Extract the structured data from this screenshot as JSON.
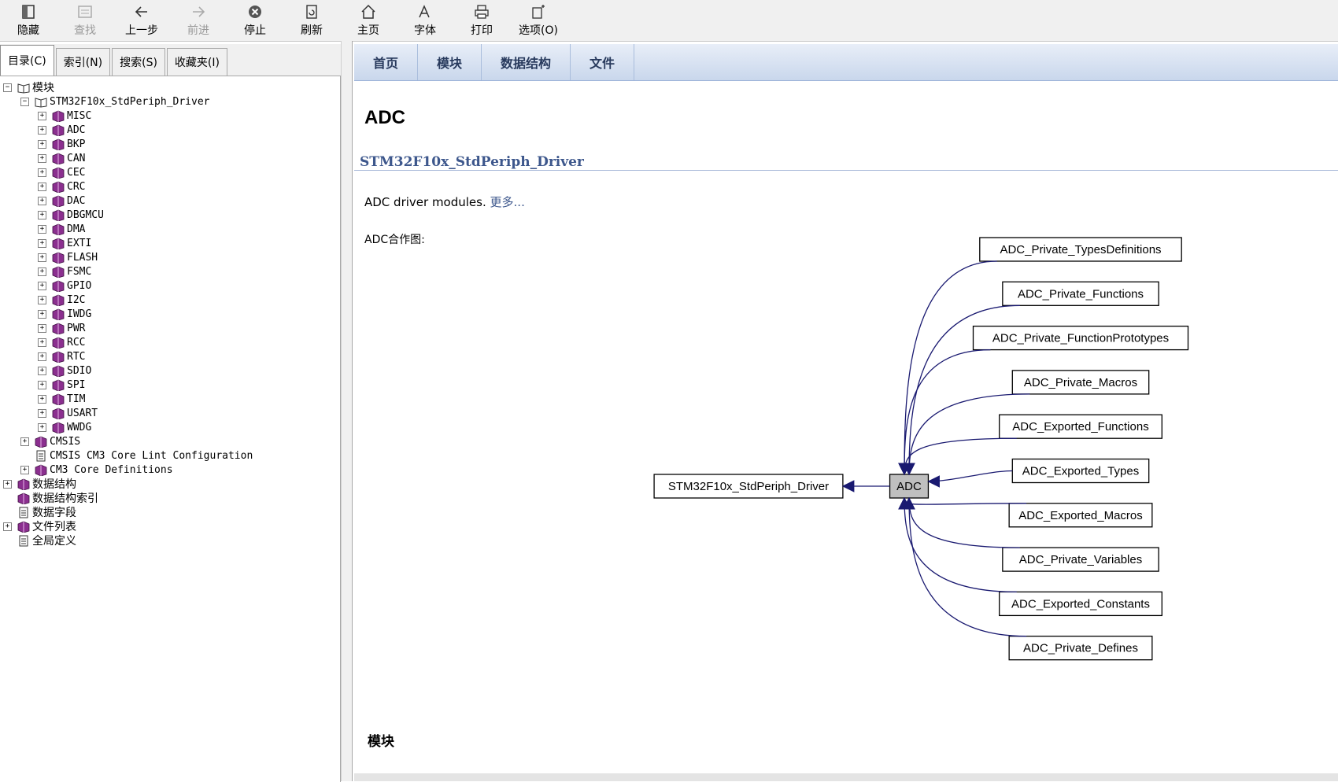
{
  "toolbar": {
    "items": [
      {
        "label": "隐藏",
        "icon": "hide-icon",
        "enabled": true
      },
      {
        "label": "查找",
        "icon": "find-icon",
        "enabled": false
      },
      {
        "label": "上一步",
        "icon": "back-arrow-icon",
        "enabled": true
      },
      {
        "label": "前进",
        "icon": "forward-arrow-icon",
        "enabled": false
      },
      {
        "label": "停止",
        "icon": "stop-icon",
        "enabled": true
      },
      {
        "label": "刷新",
        "icon": "refresh-icon",
        "enabled": true
      },
      {
        "label": "主页",
        "icon": "home-icon",
        "enabled": true
      },
      {
        "label": "字体",
        "icon": "font-icon",
        "enabled": true
      },
      {
        "label": "打印",
        "icon": "print-icon",
        "enabled": true
      },
      {
        "label": "选项(O)",
        "icon": "options-icon",
        "enabled": true
      }
    ]
  },
  "left_tabs": [
    "目录(C)",
    "索引(N)",
    "搜索(S)",
    "收藏夹(I)"
  ],
  "tree": {
    "root": "模块",
    "driver": "STM32F10x_StdPeriph_Driver",
    "modules": [
      "MISC",
      "ADC",
      "BKP",
      "CAN",
      "CEC",
      "CRC",
      "DAC",
      "DBGMCU",
      "DMA",
      "EXTI",
      "FLASH",
      "FSMC",
      "GPIO",
      "I2C",
      "IWDG",
      "PWR",
      "RCC",
      "RTC",
      "SDIO",
      "SPI",
      "TIM",
      "USART",
      "WWDG"
    ],
    "cmsis": "CMSIS",
    "cmsis_lint": "CMSIS CM3 Core Lint Configuration",
    "cm3_defs": "CM3 Core Definitions",
    "bottom": [
      {
        "label": "数据结构",
        "kind": "book",
        "expander": true
      },
      {
        "label": "数据结构索引",
        "kind": "book",
        "expander": false
      },
      {
        "label": "数据字段",
        "kind": "page",
        "expander": false
      },
      {
        "label": "文件列表",
        "kind": "book",
        "expander": true
      },
      {
        "label": "全局定义",
        "kind": "page",
        "expander": false
      }
    ]
  },
  "nav": [
    "首页",
    "模块",
    "数据结构",
    "文件"
  ],
  "page": {
    "title": "ADC",
    "ingroup": "STM32F10x_StdPeriph_Driver",
    "brief": "ADC driver modules.",
    "more": "更多...",
    "collab_label": "ADC合作图:",
    "modules_heading": "模块"
  },
  "graph": {
    "center": "ADC",
    "parent": "STM32F10x_StdPeriph_Driver",
    "children": [
      "ADC_Private_TypesDefinitions",
      "ADC_Private_Functions",
      "ADC_Private_FunctionPrototypes",
      "ADC_Private_Macros",
      "ADC_Exported_Functions",
      "ADC_Exported_Types",
      "ADC_Exported_Macros",
      "ADC_Private_Variables",
      "ADC_Exported_Constants",
      "ADC_Private_Defines"
    ],
    "colors": {
      "edge": "#191970",
      "center_fill": "#bfbfbf"
    }
  }
}
